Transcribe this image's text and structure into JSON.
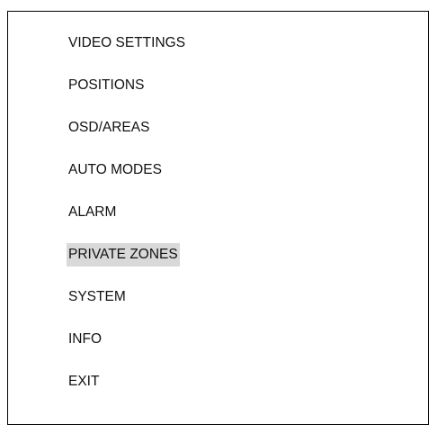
{
  "menu": {
    "items": [
      {
        "label": "VIDEO SETTINGS",
        "selected": false
      },
      {
        "label": "POSITIONS",
        "selected": false
      },
      {
        "label": "OSD/AREAS",
        "selected": false
      },
      {
        "label": "AUTO MODES",
        "selected": false
      },
      {
        "label": "ALARM",
        "selected": false
      },
      {
        "label": "PRIVATE ZONES",
        "selected": true
      },
      {
        "label": "SYSTEM",
        "selected": false
      },
      {
        "label": "INFO",
        "selected": false
      },
      {
        "label": "EXIT",
        "selected": false
      }
    ],
    "highlight_color": "#d9d9d9",
    "text_color": "#111111",
    "border_color": "#000000"
  }
}
